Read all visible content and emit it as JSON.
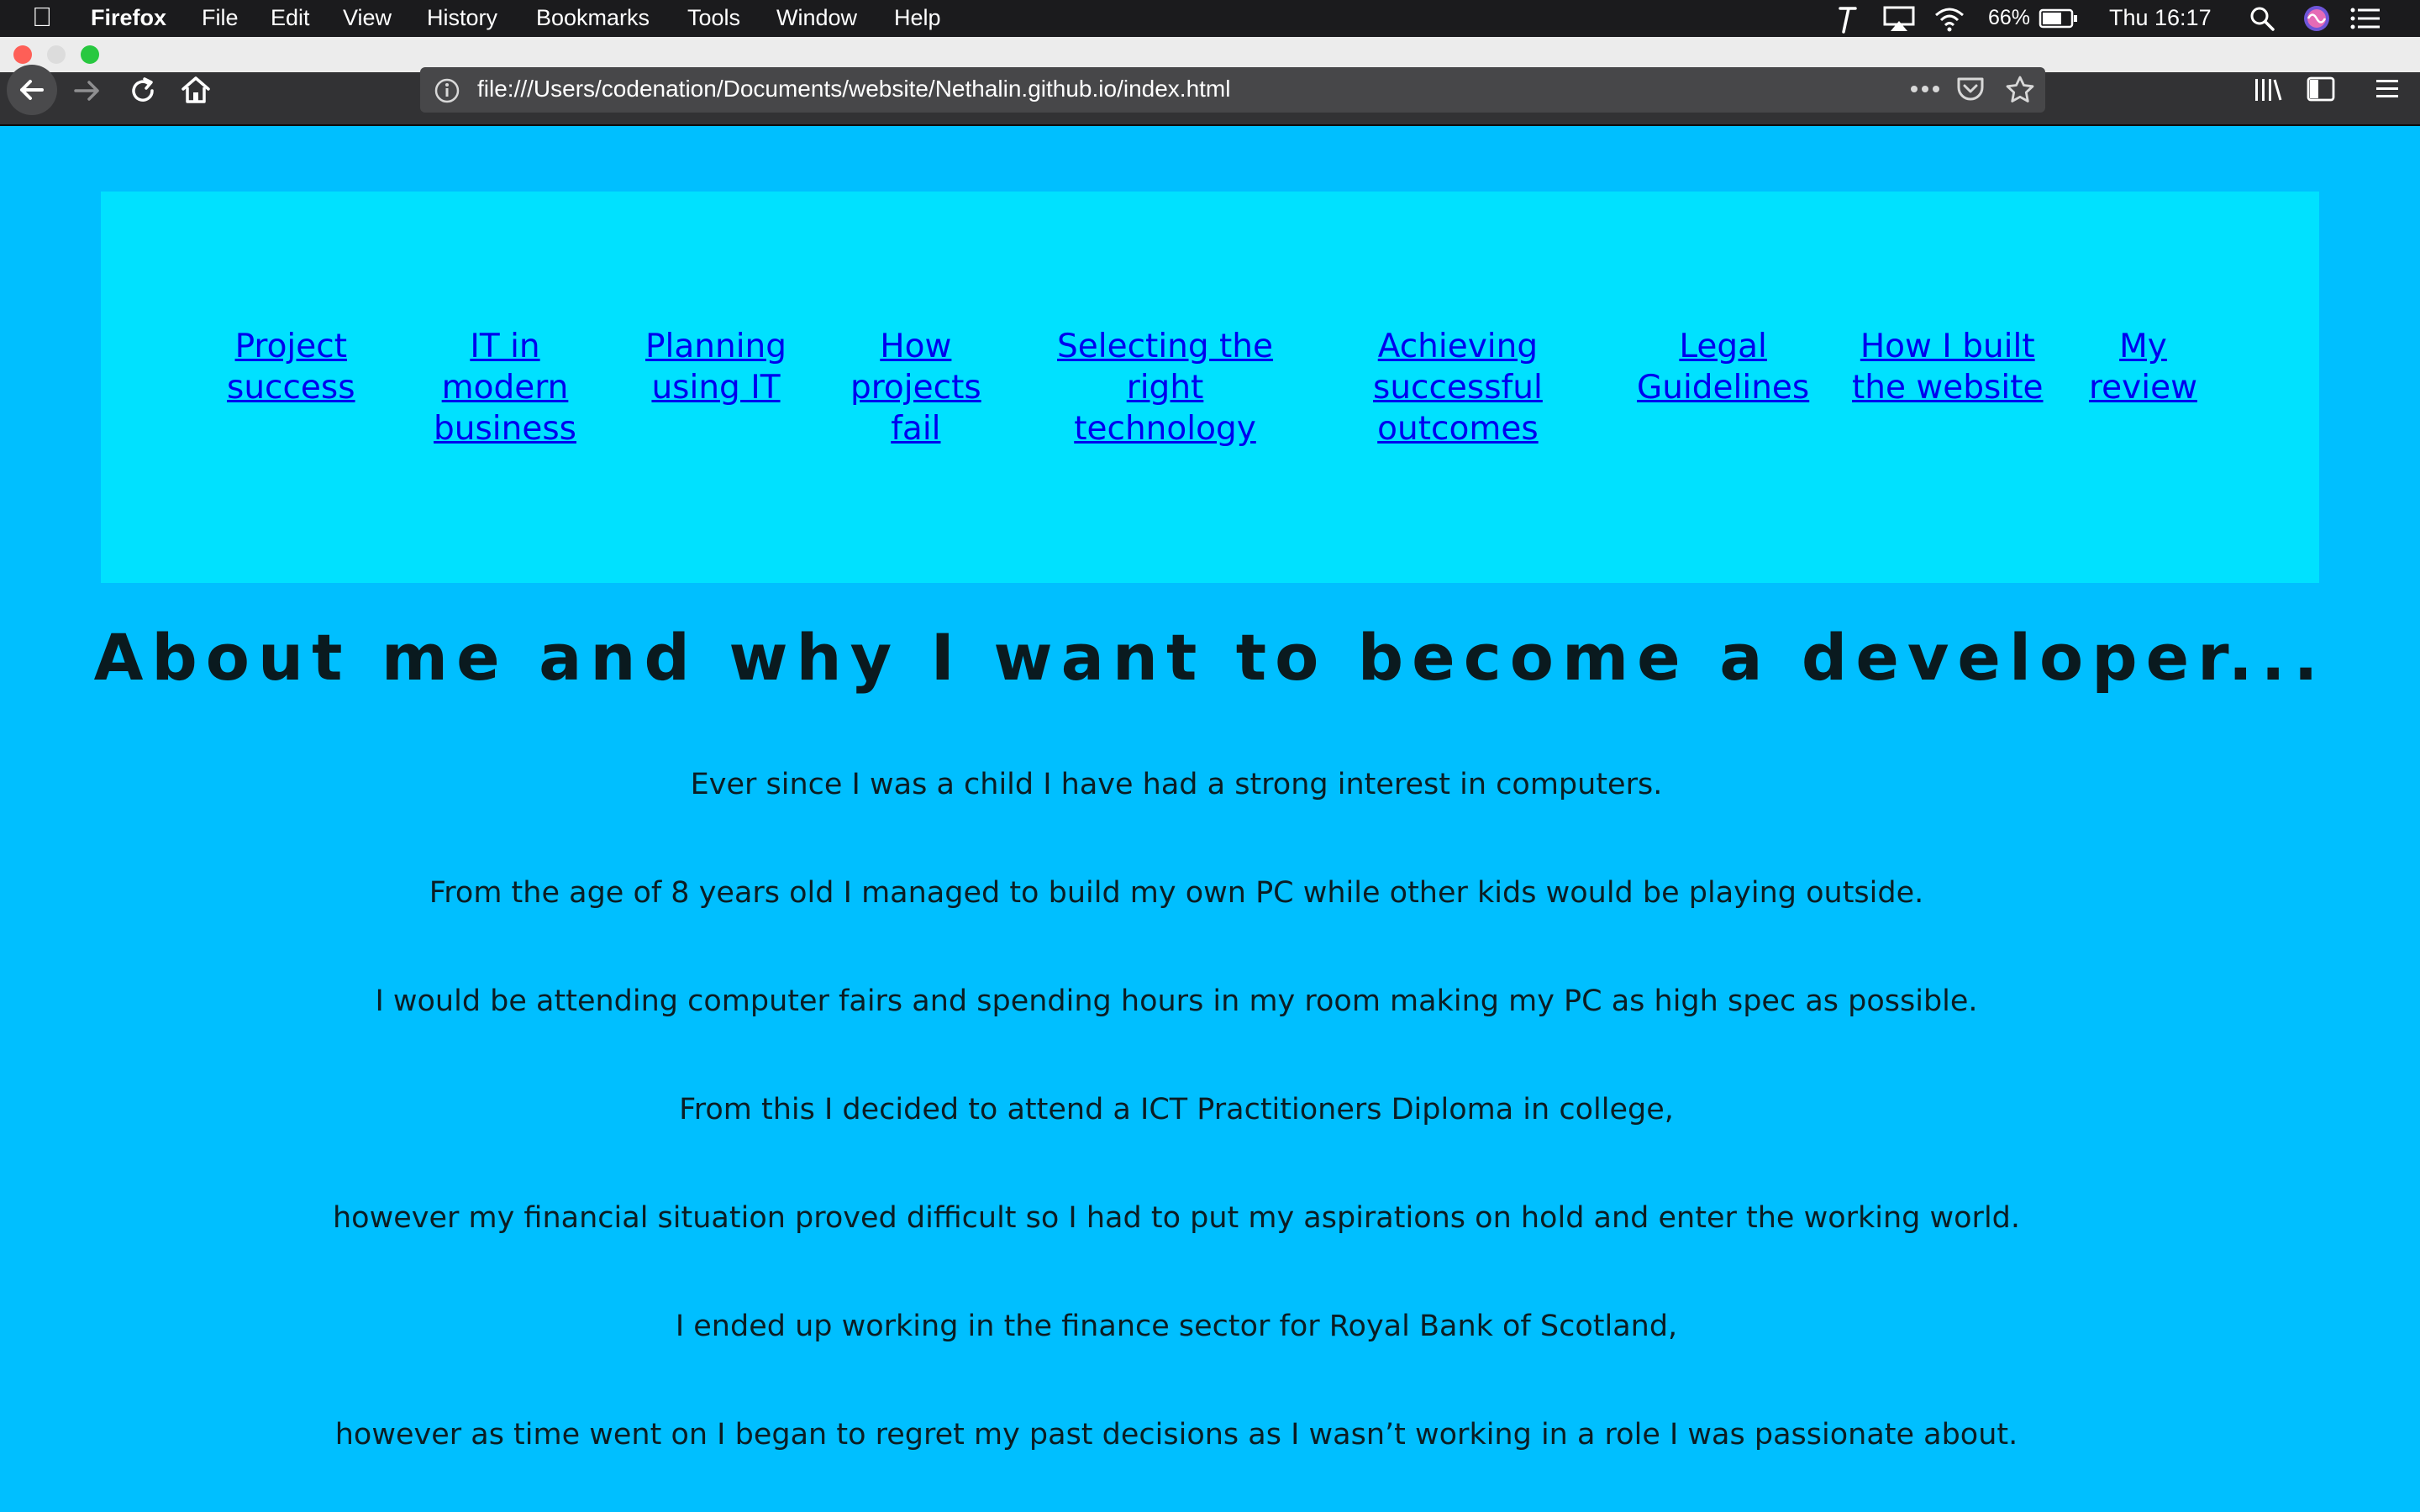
{
  "menubar": {
    "app": "Firefox",
    "menus": [
      "File",
      "Edit",
      "View",
      "History",
      "Bookmarks",
      "Tools",
      "Window",
      "Help"
    ],
    "battery": "66%",
    "clock": "Thu 16:17",
    "icons": [
      "apple-icon",
      "script-icon",
      "airplay-icon",
      "wifi-icon",
      "battery-icon",
      "spotlight-icon",
      "siri-icon",
      "notification-center-icon"
    ]
  },
  "toolbar": {
    "url": "file:///Users/codenation/Documents/website/Nethalin.github.io/index.html",
    "icons": [
      "back-icon",
      "forward-icon",
      "reload-icon",
      "home-icon",
      "info-icon",
      "page-actions-icon",
      "pocket-icon",
      "bookmark-star-icon",
      "library-icon",
      "sidebar-icon",
      "hamburger-menu-icon"
    ]
  },
  "nav": {
    "links": [
      "Project\nsuccess",
      "IT in\nmodern\nbusiness",
      "Planning\nusing IT",
      "How\nprojects\nfail",
      "Selecting the\nright\ntechnology",
      "Achieving\nsuccessful\noutcomes",
      "Legal\nGuidelines",
      "How I built\nthe website",
      "My\nreview"
    ]
  },
  "main": {
    "title": "About me and why I want to become a developer...",
    "paragraphs": [
      "Ever since I was a child I have had a strong interest in computers.",
      "From the age of 8 years old I managed to build my own PC while other kids would be playing outside.",
      "I would be attending computer fairs and spending hours in my room making my PC as high spec as possible.",
      "From this I decided to attend a ICT Practitioners Diploma in college,",
      "however my financial situation proved difficult so I had to put my aspirations on hold and enter the working world.",
      "I ended up working in the finance sector for Royal Bank of Scotland,",
      "however as time went on I began to regret my past decisions as I wasn’t working in a role I was passionate about."
    ]
  },
  "colors": {
    "page_bg": "#00bfff",
    "nav_bg": "#00e1ff",
    "link": "#0000ee",
    "menubar_bg": "#1b1b1d",
    "toolbar_bg": "#323234"
  }
}
